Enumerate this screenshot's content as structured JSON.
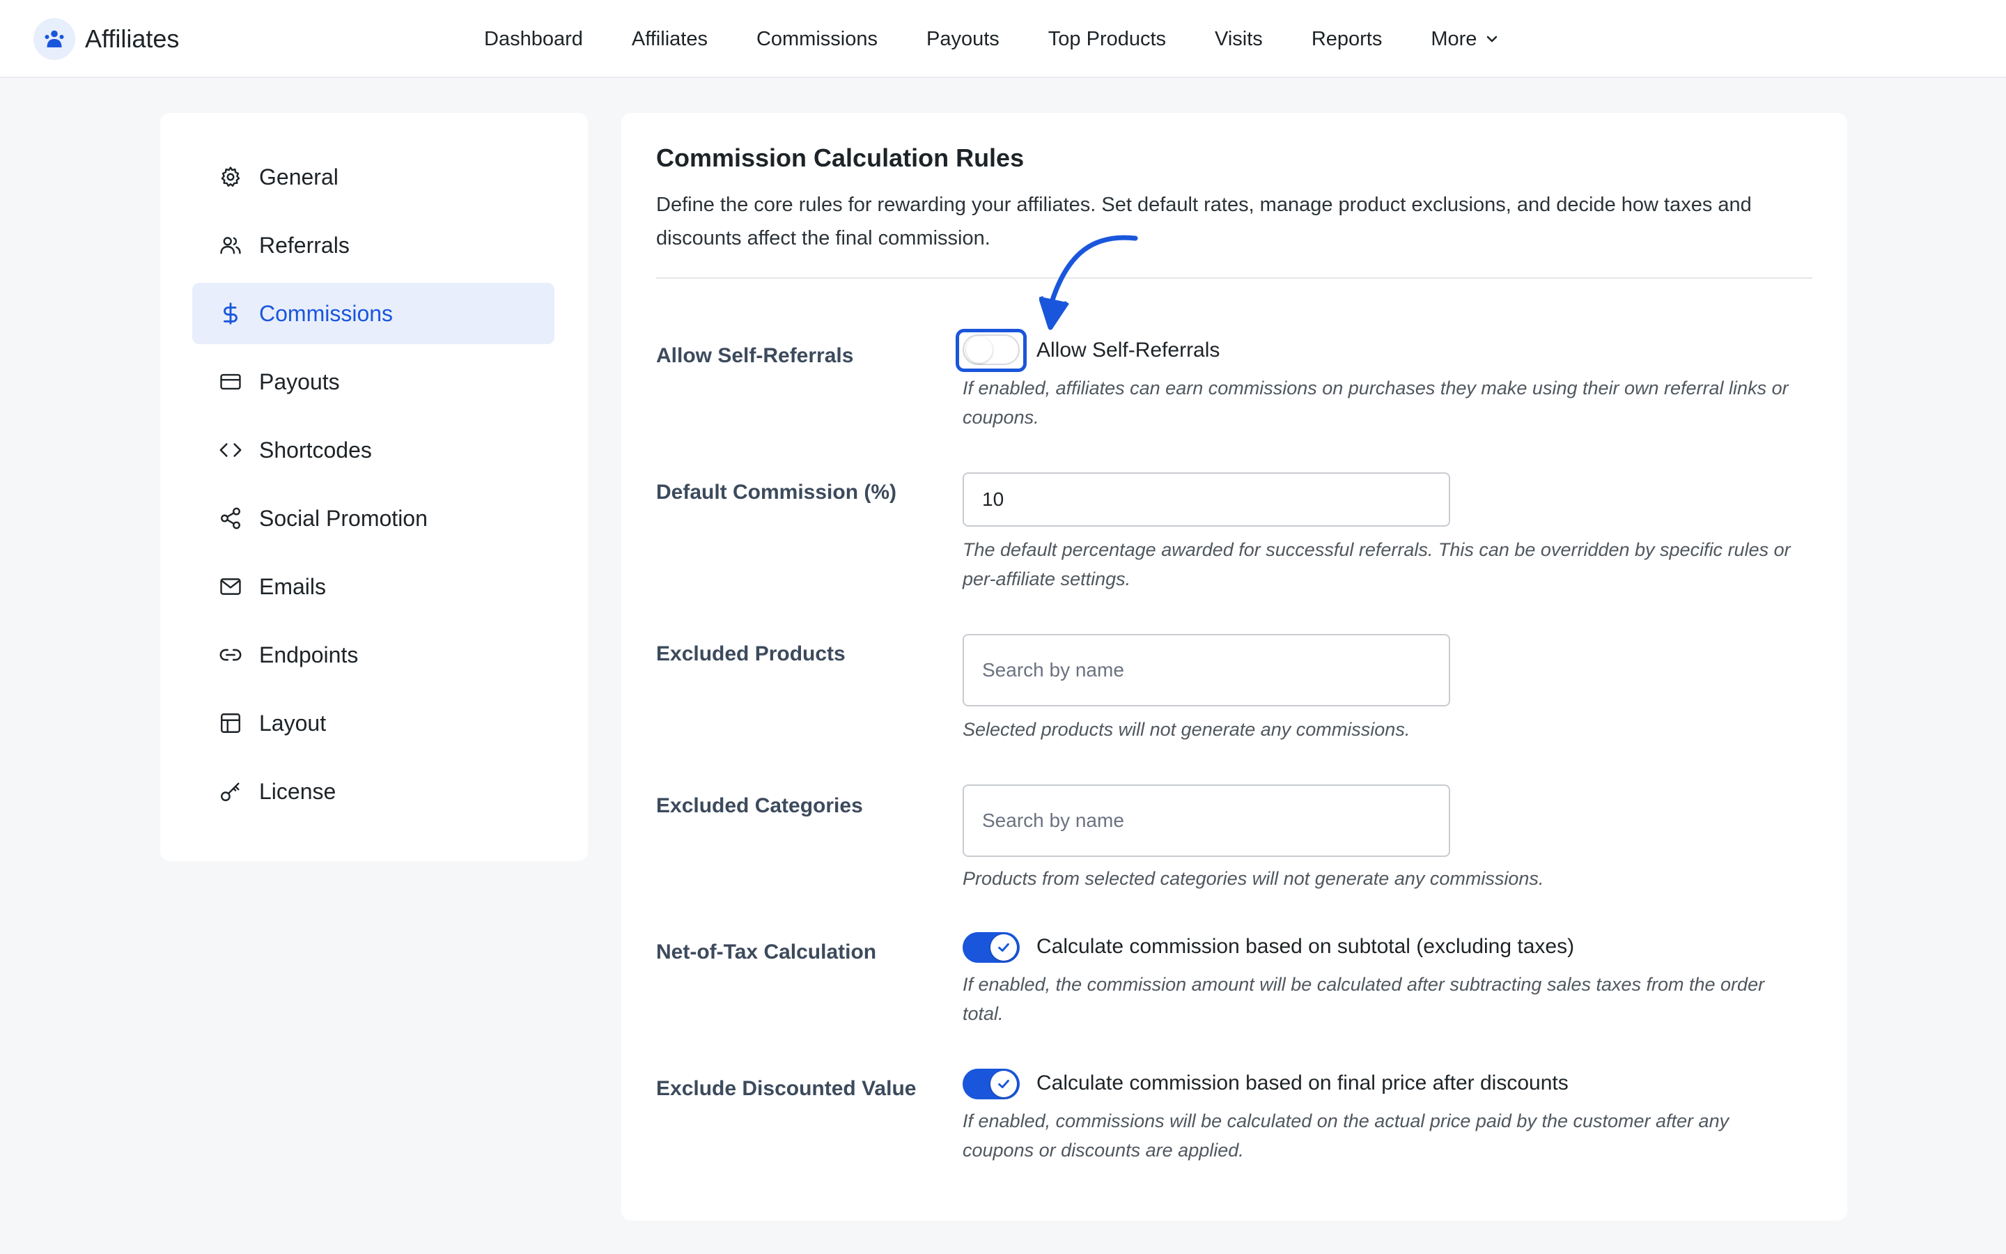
{
  "header": {
    "brand": "Affiliates",
    "nav": [
      {
        "label": "Dashboard"
      },
      {
        "label": "Affiliates"
      },
      {
        "label": "Commissions"
      },
      {
        "label": "Payouts"
      },
      {
        "label": "Top Products"
      },
      {
        "label": "Visits"
      },
      {
        "label": "Reports"
      },
      {
        "label": "More"
      }
    ]
  },
  "sidebar": {
    "items": [
      {
        "label": "General",
        "icon": "gear-icon"
      },
      {
        "label": "Referrals",
        "icon": "users-icon"
      },
      {
        "label": "Commissions",
        "icon": "dollar-icon",
        "active": true
      },
      {
        "label": "Payouts",
        "icon": "card-icon"
      },
      {
        "label": "Shortcodes",
        "icon": "code-icon"
      },
      {
        "label": "Social Promotion",
        "icon": "share-icon"
      },
      {
        "label": "Emails",
        "icon": "mail-icon"
      },
      {
        "label": "Endpoints",
        "icon": "link-icon"
      },
      {
        "label": "Layout",
        "icon": "layout-icon"
      },
      {
        "label": "License",
        "icon": "key-icon"
      }
    ]
  },
  "main": {
    "title": "Commission Calculation Rules",
    "description": "Define the core rules for rewarding your affiliates. Set default rates, manage product exclusions, and decide how taxes and discounts affect the final commission.",
    "self_referrals": {
      "label": "Allow Self-Referrals",
      "toggle_label": "Allow Self-Referrals",
      "enabled": false,
      "help": "If enabled, affiliates can earn commissions on purchases they make using their own referral links or coupons."
    },
    "default_commission": {
      "label": "Default Commission (%)",
      "value": "10",
      "help": "The default percentage awarded for successful referrals. This can be overridden by specific rules or per-affiliate settings."
    },
    "excluded_products": {
      "label": "Excluded Products",
      "placeholder": "Search by name",
      "help": "Selected products will not generate any commissions."
    },
    "excluded_categories": {
      "label": "Excluded Categories",
      "placeholder": "Search by name",
      "help": "Products from selected categories will not generate any commissions."
    },
    "net_of_tax": {
      "label": "Net-of-Tax Calculation",
      "toggle_label": "Calculate commission based on subtotal (excluding taxes)",
      "enabled": true,
      "help": "If enabled, the commission amount will be calculated after subtracting sales taxes from the order total."
    },
    "exclude_discounted": {
      "label": "Exclude Discounted Value",
      "toggle_label": "Calculate commission based on final price after discounts",
      "enabled": true,
      "help": "If enabled, commissions will be calculated on the actual price paid by the customer after any coupons or discounts are applied."
    }
  },
  "colors": {
    "accent": "#1a56db",
    "active_bg": "#e8eefc",
    "page_bg": "#f6f7f8"
  }
}
